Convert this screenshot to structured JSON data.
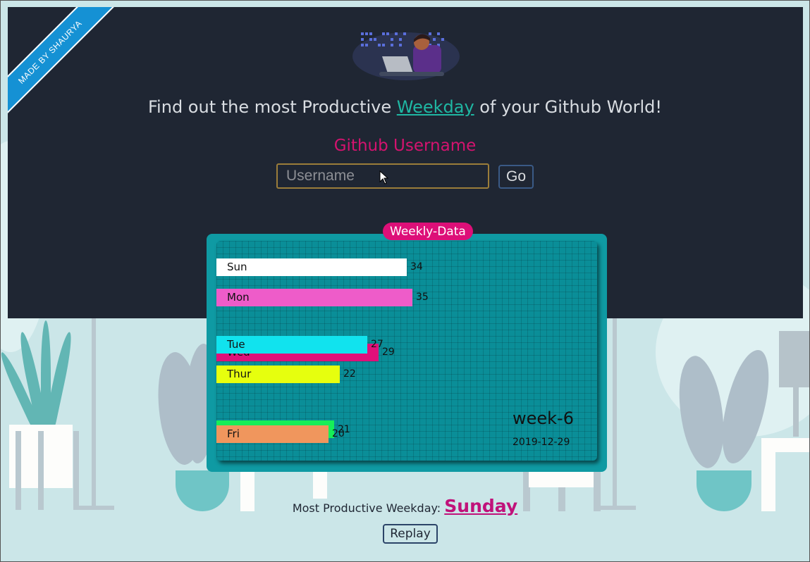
{
  "ribbon": {
    "text": "MADE BY SHAURYA"
  },
  "header": {
    "headline_before": "Find out the most Productive ",
    "headline_accent": "Weekday",
    "headline_after": " of your Github World!",
    "username_label": "Github Username"
  },
  "form": {
    "username_placeholder": "Username",
    "username_value": "",
    "go_label": "Go"
  },
  "card": {
    "tag": "Weekly-Data",
    "week_label": "week-6",
    "week_date": "2019-12-29"
  },
  "chart_data": {
    "type": "bar",
    "orientation": "horizontal",
    "categories": [
      "Sun",
      "Mon",
      "Tue",
      "Wed",
      "Thur",
      "Fri"
    ],
    "values": [
      34,
      35,
      27,
      29,
      22,
      20
    ],
    "extra_values": {
      "Sat": 21
    },
    "colors": {
      "Sun": "#ffffff",
      "Mon": "#ee5cc9",
      "Tue": "#11e3ee",
      "Wed": "#e0107a",
      "Thur": "#e6ff0e",
      "Fri": "#f0965d",
      "Sat": "#16ee57"
    }
  },
  "result": {
    "prefix": "Most Productive Weekday: ",
    "day": "Sunday"
  },
  "replay": {
    "label": "Replay"
  },
  "colors": {
    "panel": "#1f2633",
    "accent": "#1fb7a3",
    "pink": "#d4136f",
    "ribbon": "#1591d4"
  }
}
